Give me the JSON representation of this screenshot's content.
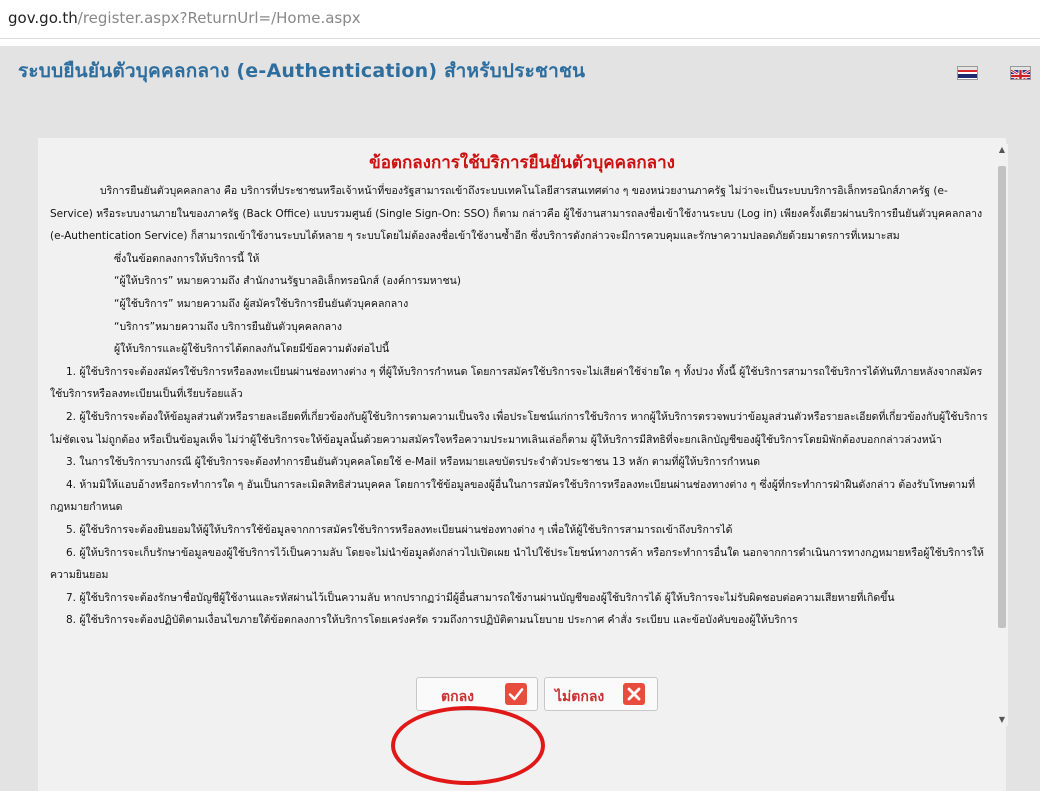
{
  "browser": {
    "url_host": "gov.go.th",
    "url_path": "/register.aspx?ReturnUrl=/Home.aspx"
  },
  "header": {
    "title": "ระบบยืนยันตัวบุคคลกลาง (e-Authentication) สำหรับประชาชน",
    "flag_th": "thai-flag-icon",
    "flag_uk": "uk-flag-icon"
  },
  "terms": {
    "title": "ข้อตกลงการใช้บริการยืนยันตัวบุคคลกลาง",
    "intro": "บริการยืนยันตัวบุคคลกลาง คือ บริการที่ประชาชนหรือเจ้าหน้าที่ของรัฐสามารถเข้าถึงระบบเทคโนโลยีสารสนเทศต่าง ๆ ของหน่วยงานภาครัฐ ไม่ว่าจะเป็นระบบบริการอิเล็กทรอนิกส์ภาครัฐ (e-Service) หรือระบบงานภายในของภาครัฐ (Back Office) แบบรวมศูนย์ (Single Sign-On: SSO) ก็ตาม กล่าวคือ ผู้ใช้งานสามารถลงชื่อเข้าใช้งานระบบ (Log in) เพียงครั้งเดียวผ่านบริการยืนยันตัวบุคคลกลาง (e-Authentication Service) ก็สามารถเข้าใช้งานระบบได้หลาย ๆ ระบบโดยไม่ต้องลงชื่อเข้าใช้งานซ้ำอีก ซึ่งบริการดังกล่าวจะมีการควบคุมและรักษาความปลอดภัยด้วยมาตรการที่เหมาะสม",
    "definitions": [
      "ซึ่งในข้อตกลงการให้บริการนี้ ให้",
      "“ผู้ให้บริการ” หมายความถึง สำนักงานรัฐบาลอิเล็กทรอนิกส์ (องค์การมหาชน)",
      "“ผู้ใช้บริการ” หมายความถึง ผู้สมัครใช้บริการยืนยันตัวบุคคลกลาง",
      "“บริการ”หมายความถึง บริการยืนยันตัวบุคคลกลาง",
      "ผู้ให้บริการและผู้ใช้บริการได้ตกลงกันโดยมีข้อความดังต่อไปนี้"
    ],
    "clauses": [
      "1. ผู้ใช้บริการจะต้องสมัครใช้บริการหรือลงทะเบียนผ่านช่องทางต่าง ๆ ที่ผู้ให้บริการกำหนด โดยการสมัครใช้บริการจะไม่เสียค่าใช้จ่ายใด ๆ ทั้งปวง ทั้งนี้ ผู้ใช้บริการสามารถใช้บริการได้ทันทีภายหลังจากสมัครใช้บริการหรือลงทะเบียนเป็นที่เรียบร้อยแล้ว",
      "2. ผู้ใช้บริการจะต้องให้ข้อมูลส่วนตัวหรือรายละเอียดที่เกี่ยวข้องกับผู้ใช้บริการตามความเป็นจริง เพื่อประโยชน์แก่การใช้บริการ หากผู้ให้บริการตรวจพบว่าข้อมูลส่วนตัวหรือรายละเอียดที่เกี่ยวข้องกับผู้ใช้บริการไม่ชัดเจน ไม่ถูกต้อง หรือเป็นข้อมูลเท็จ ไม่ว่าผู้ใช้บริการจะให้ข้อมูลนั้นด้วยความสมัครใจหรือความประมาทเลินเล่อก็ตาม ผู้ให้บริการมีสิทธิที่จะยกเลิกบัญชีของผู้ใช้บริการโดยมิพักต้องบอกกล่าวล่วงหน้า",
      "3. ในการใช้บริการบางกรณี ผู้ใช้บริการจะต้องทำการยืนยันตัวบุคคลโดยใช้ e-Mail หรือหมายเลขบัตรประจำตัวประชาชน 13 หลัก ตามที่ผู้ให้บริการกำหนด",
      "4. ห้ามมิให้แอบอ้างหรือกระทำการใด ๆ อันเป็นการละเมิดสิทธิส่วนบุคคล โดยการใช้ข้อมูลของผู้อื่นในการสมัครใช้บริการหรือลงทะเบียนผ่านช่องทางต่าง ๆ ซึ่งผู้ที่กระทำการฝ่าฝืนดังกล่าว ต้องรับโทษตามที่กฎหมายกำหนด",
      "5. ผู้ใช้บริการจะต้องยินยอมให้ผู้ให้บริการใช้ข้อมูลจากการสมัครใช้บริการหรือลงทะเบียนผ่านช่องทางต่าง ๆ เพื่อให้ผู้ใช้บริการสามารถเข้าถึงบริการได้",
      "6. ผู้ให้บริการจะเก็บรักษาข้อมูลของผู้ใช้บริการไว้เป็นความลับ โดยจะไม่นำข้อมูลดังกล่าวไปเปิดเผย นำไปใช้ประโยชน์ทางการค้า หรือกระทำการอื่นใด นอกจากการดำเนินการทางกฎหมายหรือผู้ใช้บริการให้ความยินยอม",
      "7. ผู้ใช้บริการจะต้องรักษาชื่อบัญชีผู้ใช้งานและรหัสผ่านไว้เป็นความลับ หากปรากฏว่ามีผู้อื่นสามารถใช้งานผ่านบัญชีของผู้ใช้บริการได้ ผู้ให้บริการจะไม่รับผิดชอบต่อความเสียหายที่เกิดขึ้น",
      "8. ผู้ใช้บริการจะต้องปฏิบัติตามเงื่อนไขภายใต้ข้อตกลงการให้บริการโดยเคร่งครัด รวมถึงการปฏิบัติตามนโยบาย ประกาศ คำสั่ง ระเบียบ และข้อบังคับของผู้ให้บริการ"
    ]
  },
  "buttons": {
    "accept_label": "ตกลง",
    "accept_icon": "checkmark-icon",
    "decline_label": "ไม่ตกลง",
    "decline_icon": "x-icon"
  },
  "colors": {
    "header_title": "#2e6e9e",
    "terms_title": "#cc1111",
    "button_icon": "#e84c3d",
    "highlight": "#e01818"
  }
}
